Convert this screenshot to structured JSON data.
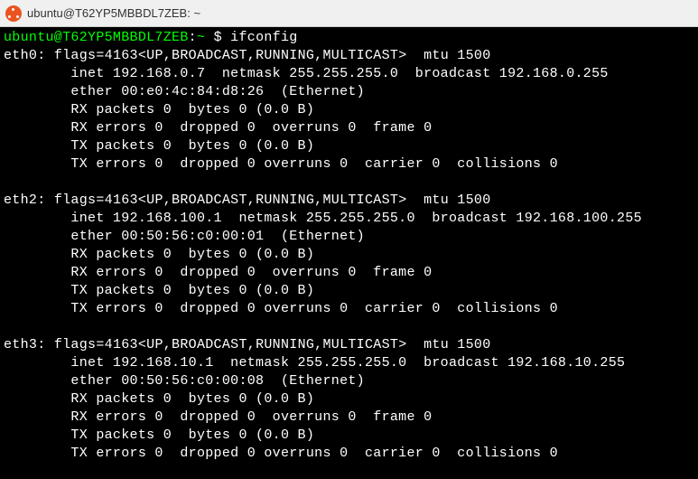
{
  "titlebar": {
    "text": "ubuntu@T62YP5MBBDL7ZEB: ~"
  },
  "prompt": {
    "user_host": "ubuntu@T62YP5MBBDL7ZEB",
    "path": "~",
    "symbol": "$",
    "command": "ifconfig"
  },
  "interfaces": [
    {
      "name": "eth0",
      "flags_line": "flags=4163<UP,BROADCAST,RUNNING,MULTICAST>  mtu 1500",
      "inet_line": "inet 192.168.0.7  netmask 255.255.255.0  broadcast 192.168.0.255",
      "ether_line": "ether 00:e0:4c:84:d8:26  (Ethernet)",
      "rx_packets": "RX packets 0  bytes 0 (0.0 B)",
      "rx_errors": "RX errors 0  dropped 0  overruns 0  frame 0",
      "tx_packets": "TX packets 0  bytes 0 (0.0 B)",
      "tx_errors": "TX errors 0  dropped 0 overruns 0  carrier 0  collisions 0"
    },
    {
      "name": "eth2",
      "flags_line": "flags=4163<UP,BROADCAST,RUNNING,MULTICAST>  mtu 1500",
      "inet_line": "inet 192.168.100.1  netmask 255.255.255.0  broadcast 192.168.100.255",
      "ether_line": "ether 00:50:56:c0:00:01  (Ethernet)",
      "rx_packets": "RX packets 0  bytes 0 (0.0 B)",
      "rx_errors": "RX errors 0  dropped 0  overruns 0  frame 0",
      "tx_packets": "TX packets 0  bytes 0 (0.0 B)",
      "tx_errors": "TX errors 0  dropped 0 overruns 0  carrier 0  collisions 0"
    },
    {
      "name": "eth3",
      "flags_line": "flags=4163<UP,BROADCAST,RUNNING,MULTICAST>  mtu 1500",
      "inet_line": "inet 192.168.10.1  netmask 255.255.255.0  broadcast 192.168.10.255",
      "ether_line": "ether 00:50:56:c0:00:08  (Ethernet)",
      "rx_packets": "RX packets 0  bytes 0 (0.0 B)",
      "rx_errors": "RX errors 0  dropped 0  overruns 0  frame 0",
      "tx_packets": "TX packets 0  bytes 0 (0.0 B)",
      "tx_errors": "TX errors 0  dropped 0 overruns 0  carrier 0  collisions 0"
    }
  ]
}
